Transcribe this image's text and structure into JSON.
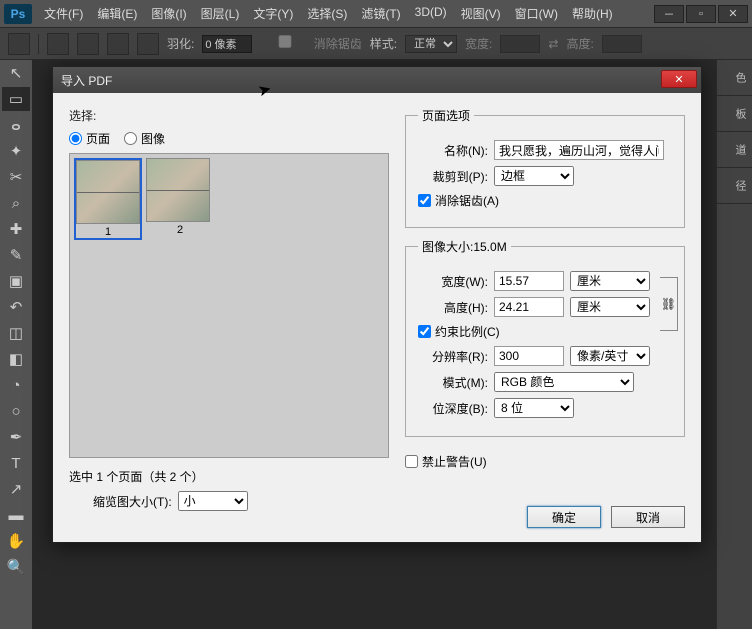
{
  "menus": [
    "文件(F)",
    "编辑(E)",
    "图像(I)",
    "图层(L)",
    "文字(Y)",
    "选择(S)",
    "滤镜(T)",
    "3D(D)",
    "视图(V)",
    "窗口(W)",
    "帮助(H)"
  ],
  "optbar": {
    "feather_label": "羽化:",
    "feather_value": "0 像素",
    "antialias": "消除锯齿",
    "style_label": "样式:",
    "style_value": "正常",
    "width_label": "宽度:",
    "height_label": "高度:"
  },
  "right_panels": [
    "色",
    "板",
    "道",
    "径"
  ],
  "dialog": {
    "title": "导入 PDF",
    "select_label": "选择:",
    "radio_page": "页面",
    "radio_image": "图像",
    "thumbs": [
      {
        "n": "1"
      },
      {
        "n": "2"
      }
    ],
    "status": "选中 1 个页面（共 2 个）",
    "thumbsize_label": "缩览图大小(T):",
    "thumbsize_value": "小",
    "page_opts": "页面选项",
    "name_label": "名称(N):",
    "name_value": "我只愿我，遍历山河，觉得人间值",
    "crop_label": "裁剪到(P):",
    "crop_value": "边框",
    "antialias_label": "消除锯齿(A)",
    "img_size_legend": "图像大小:15.0M",
    "w_label": "宽度(W):",
    "w_value": "15.57",
    "h_label": "高度(H):",
    "h_value": "24.21",
    "unit_cm": "厘米",
    "constrain": "约束比例(C)",
    "res_label": "分辨率(R):",
    "res_value": "300",
    "res_unit": "像素/英寸",
    "mode_label": "模式(M):",
    "mode_value": "RGB 颜色",
    "depth_label": "位深度(B):",
    "depth_value": "8 位",
    "suppress": "禁止警告(U)",
    "ok": "确定",
    "cancel": "取消"
  }
}
